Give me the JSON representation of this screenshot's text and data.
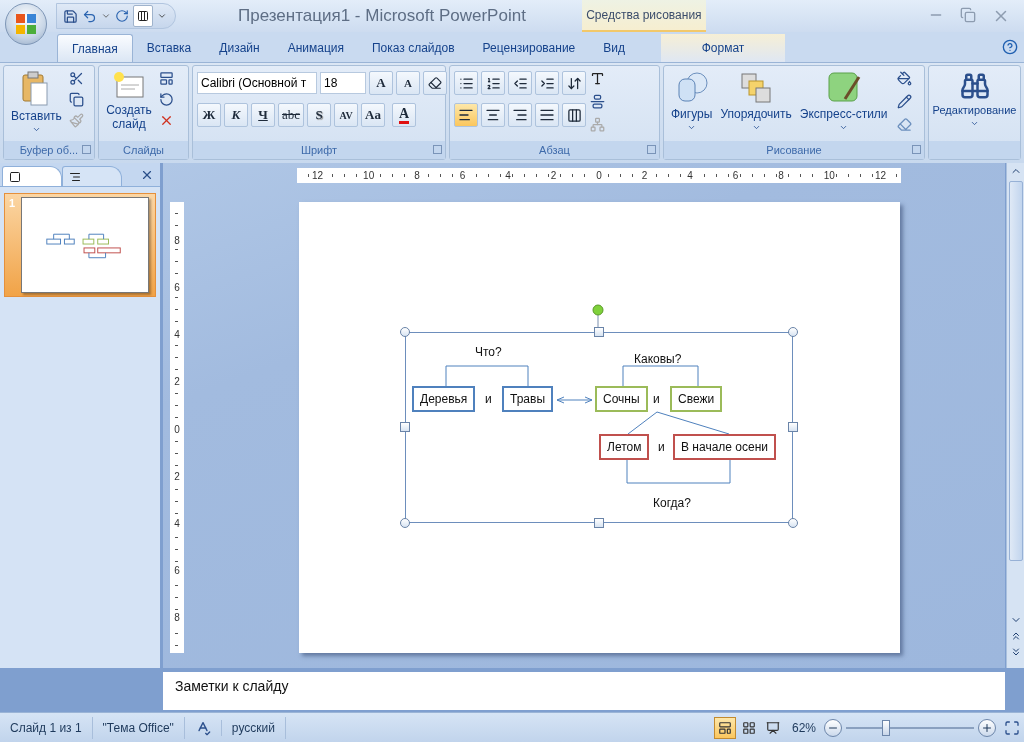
{
  "title_bar": {
    "title": "Презентация1 - Microsoft PowerPoint",
    "context_group": "Средства рисования"
  },
  "tabs": [
    {
      "label": "Главная",
      "selected": true,
      "kind": "standard"
    },
    {
      "label": "Вставка",
      "selected": false,
      "kind": "standard"
    },
    {
      "label": "Дизайн",
      "selected": false,
      "kind": "standard"
    },
    {
      "label": "Анимация",
      "selected": false,
      "kind": "standard"
    },
    {
      "label": "Показ слайдов",
      "selected": false,
      "kind": "standard"
    },
    {
      "label": "Рецензирование",
      "selected": false,
      "kind": "standard"
    },
    {
      "label": "Вид",
      "selected": false,
      "kind": "standard"
    },
    {
      "label": "Формат",
      "selected": false,
      "kind": "context"
    }
  ],
  "ribbon": {
    "clipboard": {
      "label": "Буфер об...",
      "paste": "Вставить"
    },
    "slides": {
      "label": "Слайды",
      "new_slide": "Создать слайд"
    },
    "font": {
      "label": "Шрифт",
      "font_name": "Calibri (Основной т",
      "font_size": "18",
      "size_buttons": [
        "A",
        "A"
      ],
      "format_buttons": [
        {
          "text": "Ж",
          "kind": "bold"
        },
        {
          "text": "К",
          "kind": "italic"
        },
        {
          "text": "Ч",
          "kind": "underline"
        },
        {
          "text": "abc",
          "kind": "strike"
        },
        {
          "text": "S",
          "kind": "shadow"
        },
        {
          "text": "AV",
          "kind": "spacing"
        },
        {
          "text": "Aa",
          "kind": "case"
        }
      ],
      "color_button": "A"
    },
    "paragraph": {
      "label": "Абзац",
      "align_buttons": [
        {
          "kind": "left",
          "selected": true
        },
        {
          "kind": "center",
          "selected": false
        },
        {
          "kind": "right",
          "selected": false
        },
        {
          "kind": "justify",
          "selected": false
        }
      ]
    },
    "drawing": {
      "label": "Рисование",
      "buttons": [
        "Фигуры",
        "Упорядочить",
        "Экспресс-стили"
      ]
    },
    "editing": {
      "label": "Редактирование"
    }
  },
  "slides_pane": {
    "tabs": [
      {
        "kind": "slides",
        "selected": true
      },
      {
        "kind": "outline",
        "selected": false
      }
    ],
    "thumbnails": [
      {
        "number": "1",
        "selected": true
      }
    ]
  },
  "rulers": {
    "horizontal": [
      "12",
      "10",
      "8",
      "6",
      "4",
      "2",
      "0",
      "2",
      "4",
      "6",
      "8",
      "10",
      "12"
    ],
    "vertical": [
      "8",
      "6",
      "4",
      "2",
      "0",
      "2",
      "4",
      "6",
      "8"
    ]
  },
  "slide": {
    "selected": true,
    "items": [
      {
        "kind": "label",
        "text": "Что?"
      },
      {
        "kind": "label",
        "text": "Каковы?"
      },
      {
        "kind": "box",
        "text": "Деревья",
        "color": "#4f81bd"
      },
      {
        "kind": "label",
        "text": "и"
      },
      {
        "kind": "box",
        "text": "Травы",
        "color": "#4f81bd"
      },
      {
        "kind": "box",
        "text": "Сочны",
        "color": "#9bbb59"
      },
      {
        "kind": "label",
        "text": "и"
      },
      {
        "kind": "box",
        "text": "Свежи",
        "color": "#9bbb59"
      },
      {
        "kind": "box",
        "text": "Летом",
        "color": "#c0504d"
      },
      {
        "kind": "label",
        "text": "и"
      },
      {
        "kind": "box",
        "text": "В начале осени",
        "color": "#c0504d"
      },
      {
        "kind": "label",
        "text": "Когда?"
      }
    ]
  },
  "notes": {
    "placeholder": "Заметки к слайду"
  },
  "status_bar": {
    "slide": "Слайд 1 из 1",
    "theme": "\"Тема Office\"",
    "language": "русский",
    "views": [
      {
        "kind": "normal",
        "selected": true
      },
      {
        "kind": "sorter",
        "selected": false
      },
      {
        "kind": "show",
        "selected": false
      }
    ],
    "zoom": "62%",
    "zoom_slider": {
      "level": 0.3
    }
  }
}
